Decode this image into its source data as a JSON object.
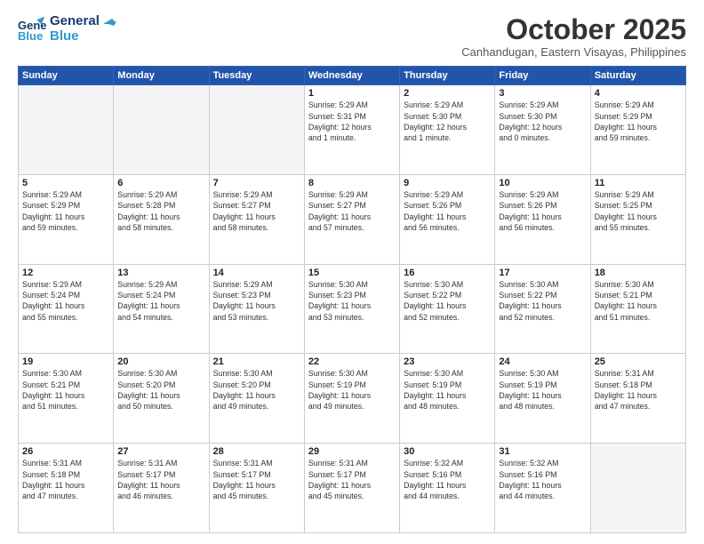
{
  "logo": {
    "general": "General",
    "blue": "Blue",
    "tagline": "BLUE"
  },
  "header": {
    "month": "October 2025",
    "location": "Canhandugan, Eastern Visayas, Philippines"
  },
  "weekdays": [
    "Sunday",
    "Monday",
    "Tuesday",
    "Wednesday",
    "Thursday",
    "Friday",
    "Saturday"
  ],
  "weeks": [
    [
      {
        "day": "",
        "info": ""
      },
      {
        "day": "",
        "info": ""
      },
      {
        "day": "",
        "info": ""
      },
      {
        "day": "1",
        "info": "Sunrise: 5:29 AM\nSunset: 5:31 PM\nDaylight: 12 hours\nand 1 minute."
      },
      {
        "day": "2",
        "info": "Sunrise: 5:29 AM\nSunset: 5:30 PM\nDaylight: 12 hours\nand 1 minute."
      },
      {
        "day": "3",
        "info": "Sunrise: 5:29 AM\nSunset: 5:30 PM\nDaylight: 12 hours\nand 0 minutes."
      },
      {
        "day": "4",
        "info": "Sunrise: 5:29 AM\nSunset: 5:29 PM\nDaylight: 11 hours\nand 59 minutes."
      }
    ],
    [
      {
        "day": "5",
        "info": "Sunrise: 5:29 AM\nSunset: 5:29 PM\nDaylight: 11 hours\nand 59 minutes."
      },
      {
        "day": "6",
        "info": "Sunrise: 5:29 AM\nSunset: 5:28 PM\nDaylight: 11 hours\nand 58 minutes."
      },
      {
        "day": "7",
        "info": "Sunrise: 5:29 AM\nSunset: 5:27 PM\nDaylight: 11 hours\nand 58 minutes."
      },
      {
        "day": "8",
        "info": "Sunrise: 5:29 AM\nSunset: 5:27 PM\nDaylight: 11 hours\nand 57 minutes."
      },
      {
        "day": "9",
        "info": "Sunrise: 5:29 AM\nSunset: 5:26 PM\nDaylight: 11 hours\nand 56 minutes."
      },
      {
        "day": "10",
        "info": "Sunrise: 5:29 AM\nSunset: 5:26 PM\nDaylight: 11 hours\nand 56 minutes."
      },
      {
        "day": "11",
        "info": "Sunrise: 5:29 AM\nSunset: 5:25 PM\nDaylight: 11 hours\nand 55 minutes."
      }
    ],
    [
      {
        "day": "12",
        "info": "Sunrise: 5:29 AM\nSunset: 5:24 PM\nDaylight: 11 hours\nand 55 minutes."
      },
      {
        "day": "13",
        "info": "Sunrise: 5:29 AM\nSunset: 5:24 PM\nDaylight: 11 hours\nand 54 minutes."
      },
      {
        "day": "14",
        "info": "Sunrise: 5:29 AM\nSunset: 5:23 PM\nDaylight: 11 hours\nand 53 minutes."
      },
      {
        "day": "15",
        "info": "Sunrise: 5:30 AM\nSunset: 5:23 PM\nDaylight: 11 hours\nand 53 minutes."
      },
      {
        "day": "16",
        "info": "Sunrise: 5:30 AM\nSunset: 5:22 PM\nDaylight: 11 hours\nand 52 minutes."
      },
      {
        "day": "17",
        "info": "Sunrise: 5:30 AM\nSunset: 5:22 PM\nDaylight: 11 hours\nand 52 minutes."
      },
      {
        "day": "18",
        "info": "Sunrise: 5:30 AM\nSunset: 5:21 PM\nDaylight: 11 hours\nand 51 minutes."
      }
    ],
    [
      {
        "day": "19",
        "info": "Sunrise: 5:30 AM\nSunset: 5:21 PM\nDaylight: 11 hours\nand 51 minutes."
      },
      {
        "day": "20",
        "info": "Sunrise: 5:30 AM\nSunset: 5:20 PM\nDaylight: 11 hours\nand 50 minutes."
      },
      {
        "day": "21",
        "info": "Sunrise: 5:30 AM\nSunset: 5:20 PM\nDaylight: 11 hours\nand 49 minutes."
      },
      {
        "day": "22",
        "info": "Sunrise: 5:30 AM\nSunset: 5:19 PM\nDaylight: 11 hours\nand 49 minutes."
      },
      {
        "day": "23",
        "info": "Sunrise: 5:30 AM\nSunset: 5:19 PM\nDaylight: 11 hours\nand 48 minutes."
      },
      {
        "day": "24",
        "info": "Sunrise: 5:30 AM\nSunset: 5:19 PM\nDaylight: 11 hours\nand 48 minutes."
      },
      {
        "day": "25",
        "info": "Sunrise: 5:31 AM\nSunset: 5:18 PM\nDaylight: 11 hours\nand 47 minutes."
      }
    ],
    [
      {
        "day": "26",
        "info": "Sunrise: 5:31 AM\nSunset: 5:18 PM\nDaylight: 11 hours\nand 47 minutes."
      },
      {
        "day": "27",
        "info": "Sunrise: 5:31 AM\nSunset: 5:17 PM\nDaylight: 11 hours\nand 46 minutes."
      },
      {
        "day": "28",
        "info": "Sunrise: 5:31 AM\nSunset: 5:17 PM\nDaylight: 11 hours\nand 45 minutes."
      },
      {
        "day": "29",
        "info": "Sunrise: 5:31 AM\nSunset: 5:17 PM\nDaylight: 11 hours\nand 45 minutes."
      },
      {
        "day": "30",
        "info": "Sunrise: 5:32 AM\nSunset: 5:16 PM\nDaylight: 11 hours\nand 44 minutes."
      },
      {
        "day": "31",
        "info": "Sunrise: 5:32 AM\nSunset: 5:16 PM\nDaylight: 11 hours\nand 44 minutes."
      },
      {
        "day": "",
        "info": ""
      }
    ]
  ]
}
